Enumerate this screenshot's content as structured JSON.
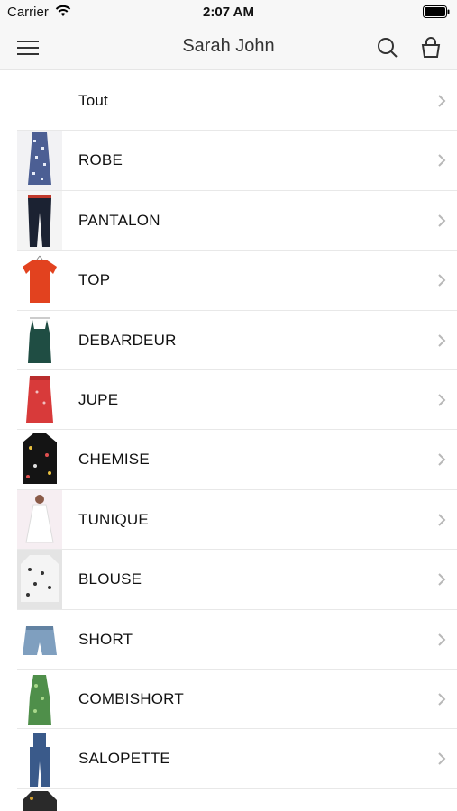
{
  "status_bar": {
    "carrier": "Carrier",
    "time": "2:07 AM"
  },
  "nav": {
    "title": "Sarah John",
    "menu_icon": "menu-icon",
    "search_icon": "search-icon",
    "bag_icon": "shopping-bag-icon"
  },
  "categories": [
    {
      "label": "Tout"
    },
    {
      "label": "ROBE",
      "thumb": "dress"
    },
    {
      "label": "PANTALON",
      "thumb": "pants"
    },
    {
      "label": "TOP",
      "thumb": "top"
    },
    {
      "label": "DEBARDEUR",
      "thumb": "tank-top"
    },
    {
      "label": "JUPE",
      "thumb": "skirt"
    },
    {
      "label": "CHEMISE",
      "thumb": "shirt"
    },
    {
      "label": "TUNIQUE",
      "thumb": "tunic"
    },
    {
      "label": "BLOUSE",
      "thumb": "blouse"
    },
    {
      "label": "SHORT",
      "thumb": "shorts"
    },
    {
      "label": "COMBISHORT",
      "thumb": "romper"
    },
    {
      "label": "SALOPETTE",
      "thumb": "overalls"
    },
    {
      "label": "",
      "thumb": "jacket"
    }
  ],
  "colors": {
    "chevron": "#b8b8b8",
    "separator": "#e8e8e8",
    "bar": "#f7f7f7"
  }
}
